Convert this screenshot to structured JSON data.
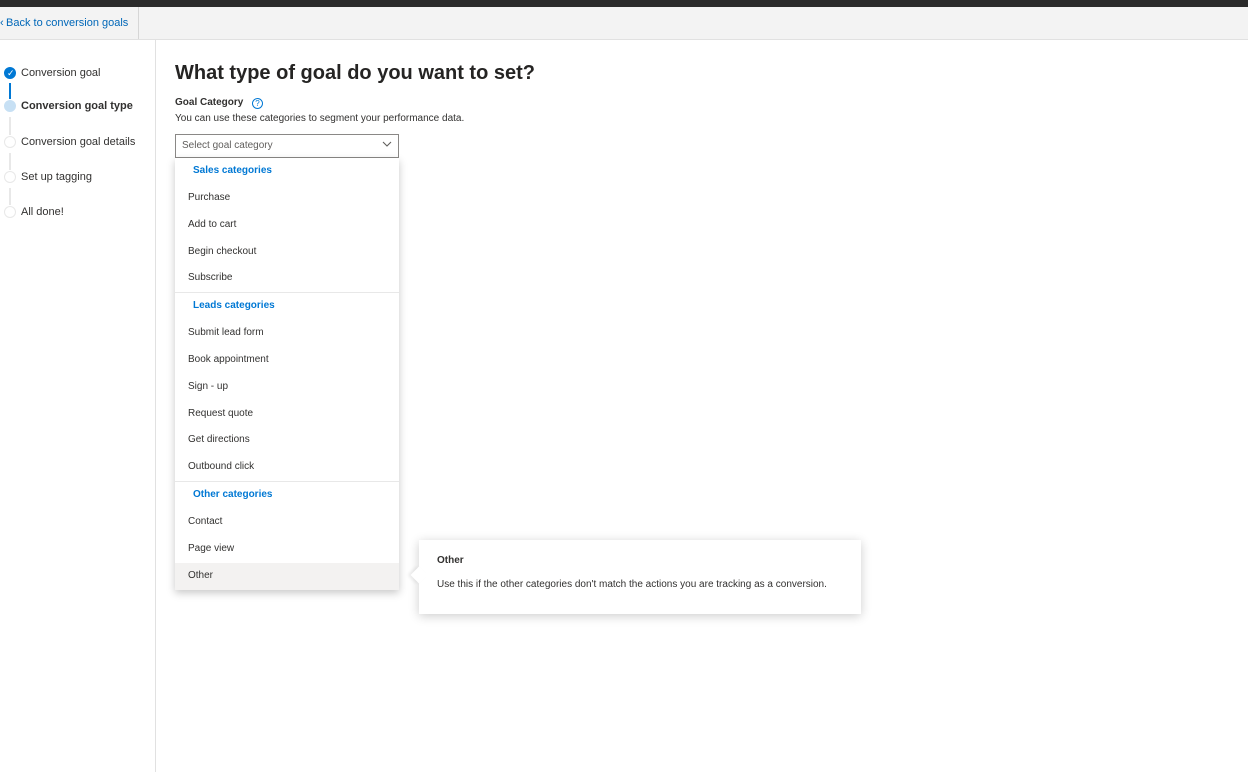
{
  "header": {
    "back_link": "Back to conversion goals"
  },
  "sidebar": {
    "steps": [
      {
        "label": "Conversion goal",
        "state": "complete"
      },
      {
        "label": "Conversion goal type",
        "state": "current"
      },
      {
        "label": "Conversion goal details",
        "state": "pending"
      },
      {
        "label": "Set up tagging",
        "state": "pending"
      },
      {
        "label": "All done!",
        "state": "pending"
      }
    ]
  },
  "main": {
    "title": "What type of goal do you want to set?",
    "field_label": "Goal Category",
    "help_glyph": "?",
    "field_description": "You can use these categories to segment your performance data.",
    "select_placeholder": "Select goal category"
  },
  "dropdown": {
    "groups": [
      {
        "header": "Sales categories",
        "options": [
          "Purchase",
          "Add to cart",
          "Begin checkout",
          "Subscribe"
        ]
      },
      {
        "header": "Leads categories",
        "options": [
          "Submit lead form",
          "Book appointment",
          "Sign - up",
          "Request quote",
          "Get directions",
          "Outbound click"
        ]
      },
      {
        "header": "Other categories",
        "options": [
          "Contact",
          "Page view",
          "Other"
        ]
      }
    ],
    "hovered_option": "Other"
  },
  "tooltip": {
    "title": "Other",
    "body": "Use this if the other categories don't match the actions you are tracking as a conversion."
  },
  "colors": {
    "accent": "#0078d4",
    "link": "#0067b8",
    "text": "#323130",
    "hover_bg": "#f3f2f1"
  },
  "icons": {
    "back": "back-arrow-icon",
    "complete_step": "checkmark-icon",
    "help": "help-circle-icon",
    "select": "chevron-down-icon"
  }
}
